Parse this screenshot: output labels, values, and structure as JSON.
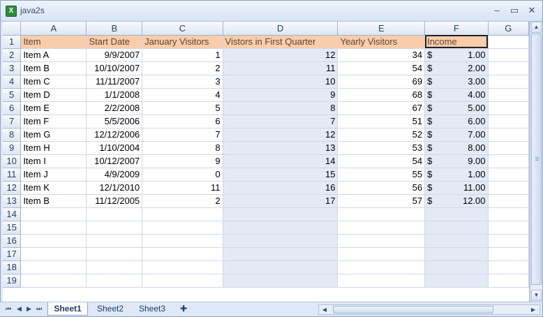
{
  "window": {
    "title": "java2s",
    "icon": "excel-icon"
  },
  "columns": [
    "A",
    "B",
    "C",
    "D",
    "E",
    "F",
    "G"
  ],
  "header_row": [
    "Item",
    "Start Date",
    "January Visitors",
    "Vistors in First Quarter",
    "Yearly Visitors",
    "Income"
  ],
  "rows": [
    [
      "Item A",
      "9/9/2007",
      "1",
      "12",
      "34",
      "1.00"
    ],
    [
      "Item B",
      "10/10/2007",
      "2",
      "11",
      "54",
      "2.00"
    ],
    [
      "Item C",
      "11/11/2007",
      "3",
      "10",
      "69",
      "3.00"
    ],
    [
      "Item D",
      "1/1/2008",
      "4",
      "9",
      "68",
      "4.00"
    ],
    [
      "Item E",
      "2/2/2008",
      "5",
      "8",
      "67",
      "5.00"
    ],
    [
      "Item F",
      "5/5/2006",
      "6",
      "7",
      "51",
      "6.00"
    ],
    [
      "Item G",
      "12/12/2006",
      "7",
      "12",
      "52",
      "7.00"
    ],
    [
      "Item H",
      "1/10/2004",
      "8",
      "13",
      "53",
      "8.00"
    ],
    [
      "Item I",
      "10/12/2007",
      "9",
      "14",
      "54",
      "9.00"
    ],
    [
      "Item J",
      "4/9/2009",
      "0",
      "15",
      "55",
      "1.00"
    ],
    [
      "Item K",
      "12/1/2010",
      "11",
      "16",
      "56",
      "11.00"
    ],
    [
      "Item B",
      "11/12/2005",
      "2",
      "17",
      "57",
      "12.00"
    ]
  ],
  "currency_symbol": "$",
  "row_numbers": [
    "1",
    "2",
    "3",
    "4",
    "5",
    "6",
    "7",
    "8",
    "9",
    "10",
    "11",
    "12",
    "13",
    "14",
    "15",
    "16",
    "17",
    "18",
    "19"
  ],
  "sheet_tabs": [
    "Sheet1",
    "Sheet2",
    "Sheet3"
  ],
  "active_sheet": "Sheet1",
  "colors": {
    "header_fill": "#f9ccab",
    "column_shade": "#e3e9f5",
    "selected_header": "#f8cc7a"
  }
}
